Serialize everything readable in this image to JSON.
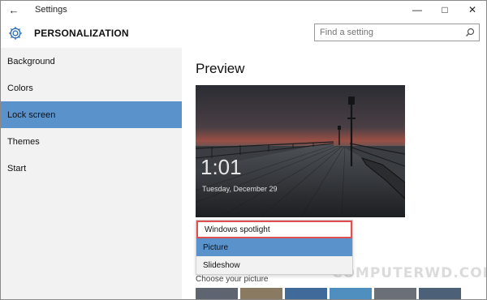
{
  "window": {
    "title": "Settings",
    "back_icon": "back-arrow-icon",
    "controls": [
      "minimize-icon",
      "maximize-icon",
      "close-icon"
    ]
  },
  "header": {
    "section_title": "PERSONALIZATION",
    "icon": "gear-icon"
  },
  "search": {
    "placeholder": "Find a setting",
    "icon": "search-icon"
  },
  "sidebar": {
    "items": [
      {
        "label": "Background"
      },
      {
        "label": "Colors"
      },
      {
        "label": "Lock screen",
        "active": true
      },
      {
        "label": "Themes"
      },
      {
        "label": "Start"
      }
    ],
    "active_color": "#5a93cc"
  },
  "main": {
    "preview_title": "Preview",
    "lock_time": "1:01",
    "lock_date": "Tuesday, December 29",
    "choose_label": "Choose your picture"
  },
  "dropdown": {
    "options": [
      {
        "label": "Windows spotlight",
        "state": "current"
      },
      {
        "label": "Picture",
        "state": "selected"
      },
      {
        "label": "Slideshow",
        "state": "normal"
      }
    ],
    "highlight_color": "#e05050"
  },
  "watermark": "COMPUTERWD.COM"
}
